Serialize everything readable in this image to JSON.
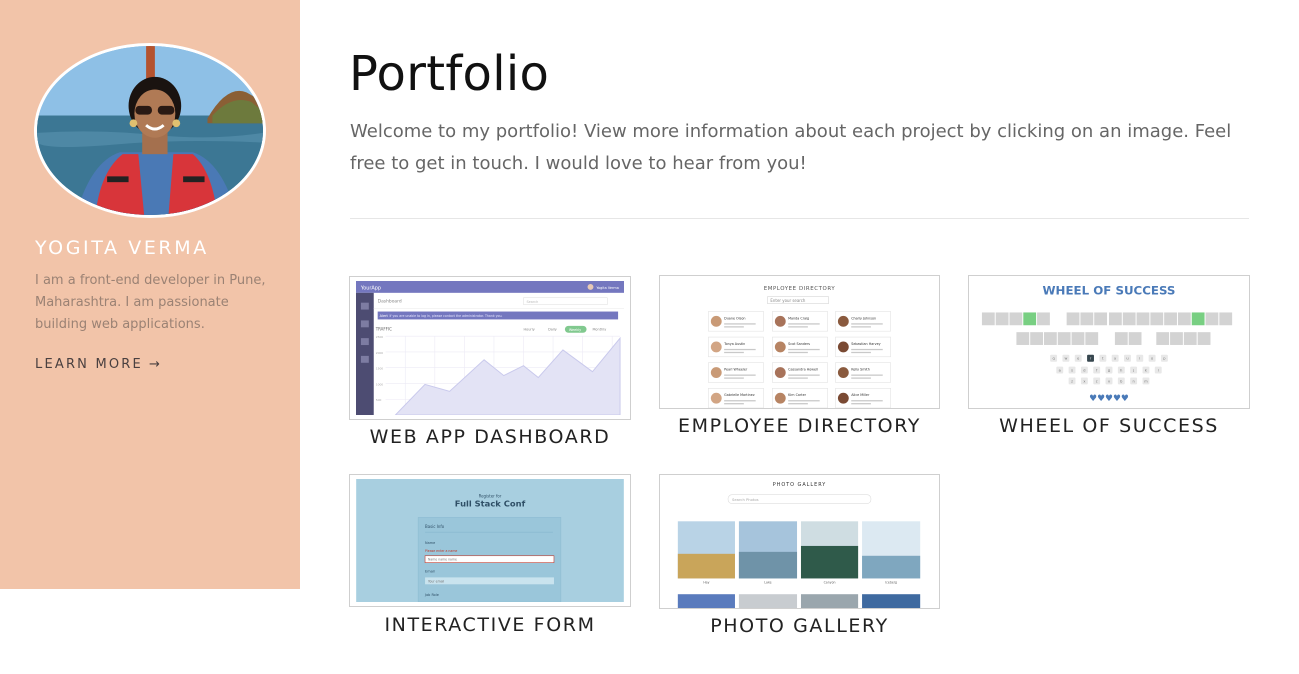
{
  "sidebar": {
    "name": "YOGITA VERMA",
    "bio": "I am a front-end developer in Pune, Maharashtra. I am passionate building web applications.",
    "learn_more": "LEARN MORE",
    "arrow": "→"
  },
  "main": {
    "title": "Portfolio",
    "intro": "Welcome to my portfolio! View more information about each project by clicking on an image. Feel free to get in touch. I would love to hear from you!"
  },
  "projects": [
    {
      "caption": "WEB APP DASHBOARD"
    },
    {
      "caption": "EMPLOYEE DIRECTORY"
    },
    {
      "caption": "WHEEL OF SUCCESS"
    },
    {
      "caption": "INTERACTIVE FORM"
    },
    {
      "caption": "PHOTO GALLERY"
    }
  ],
  "thumbnails": {
    "dashboard": {
      "logo": "YourApp",
      "user": "Yogita Verma",
      "heading": "Dashboard",
      "search": "Search",
      "alert_tag": "Alert",
      "alert_text": "If you are unable to log in, please contact the administrator. Thank you.",
      "traffic": "TRAFFIC",
      "periods": [
        "Hourly",
        "Daily",
        "Weekly",
        "Monthly"
      ],
      "active_period": "Weekly",
      "y_ticks": [
        "2500",
        "2000",
        "1500",
        "1000",
        "500"
      ]
    },
    "employees": {
      "title": "EMPLOYEE DIRECTORY",
      "search": "Enter your search",
      "people": [
        "Duane Olson",
        "Manda Craig",
        "Charly Johnson",
        "Tonya Austin",
        "Scot Sanders",
        "Sebastian Harvey",
        "Pearl Wheeler",
        "Cassandra Howell",
        "Kelly Smith",
        "Gabrielle Martinez",
        "Kim Carter",
        "Alice Miller"
      ]
    },
    "wheel": {
      "title": "WHEEL OF SUCCESS",
      "keys_row1": [
        "q",
        "w",
        "e",
        "r",
        "t",
        "y",
        "u",
        "i",
        "o",
        "p"
      ],
      "keys_row2": [
        "a",
        "s",
        "d",
        "f",
        "g",
        "h",
        "j",
        "k",
        "l"
      ],
      "keys_row3": [
        "z",
        "x",
        "c",
        "v",
        "b",
        "n",
        "m"
      ],
      "hearts": "♥♥♥♥♥"
    },
    "form": {
      "register_for": "Register for",
      "conf_name": "Full Stack Conf",
      "section": "Basic Info",
      "name_label": "Name",
      "name_error": "Please enter a name",
      "name_placeholder": "Name name name",
      "email_label": "Email",
      "email_placeholder": "Your email",
      "job_label": "Job Role"
    },
    "gallery": {
      "title": "PHOTO GALLERY",
      "search": "Search Photos",
      "photo_labels": [
        "Hay",
        "Lake",
        "Canyon",
        "Iceberg"
      ]
    }
  },
  "colors": {
    "sidebar_bg": "#f2c4a9",
    "accent_purple": "#7477bf",
    "wheel_blue": "#4a7ab8",
    "wheel_green": "#78cf82",
    "form_bg": "#a8cfe0"
  }
}
